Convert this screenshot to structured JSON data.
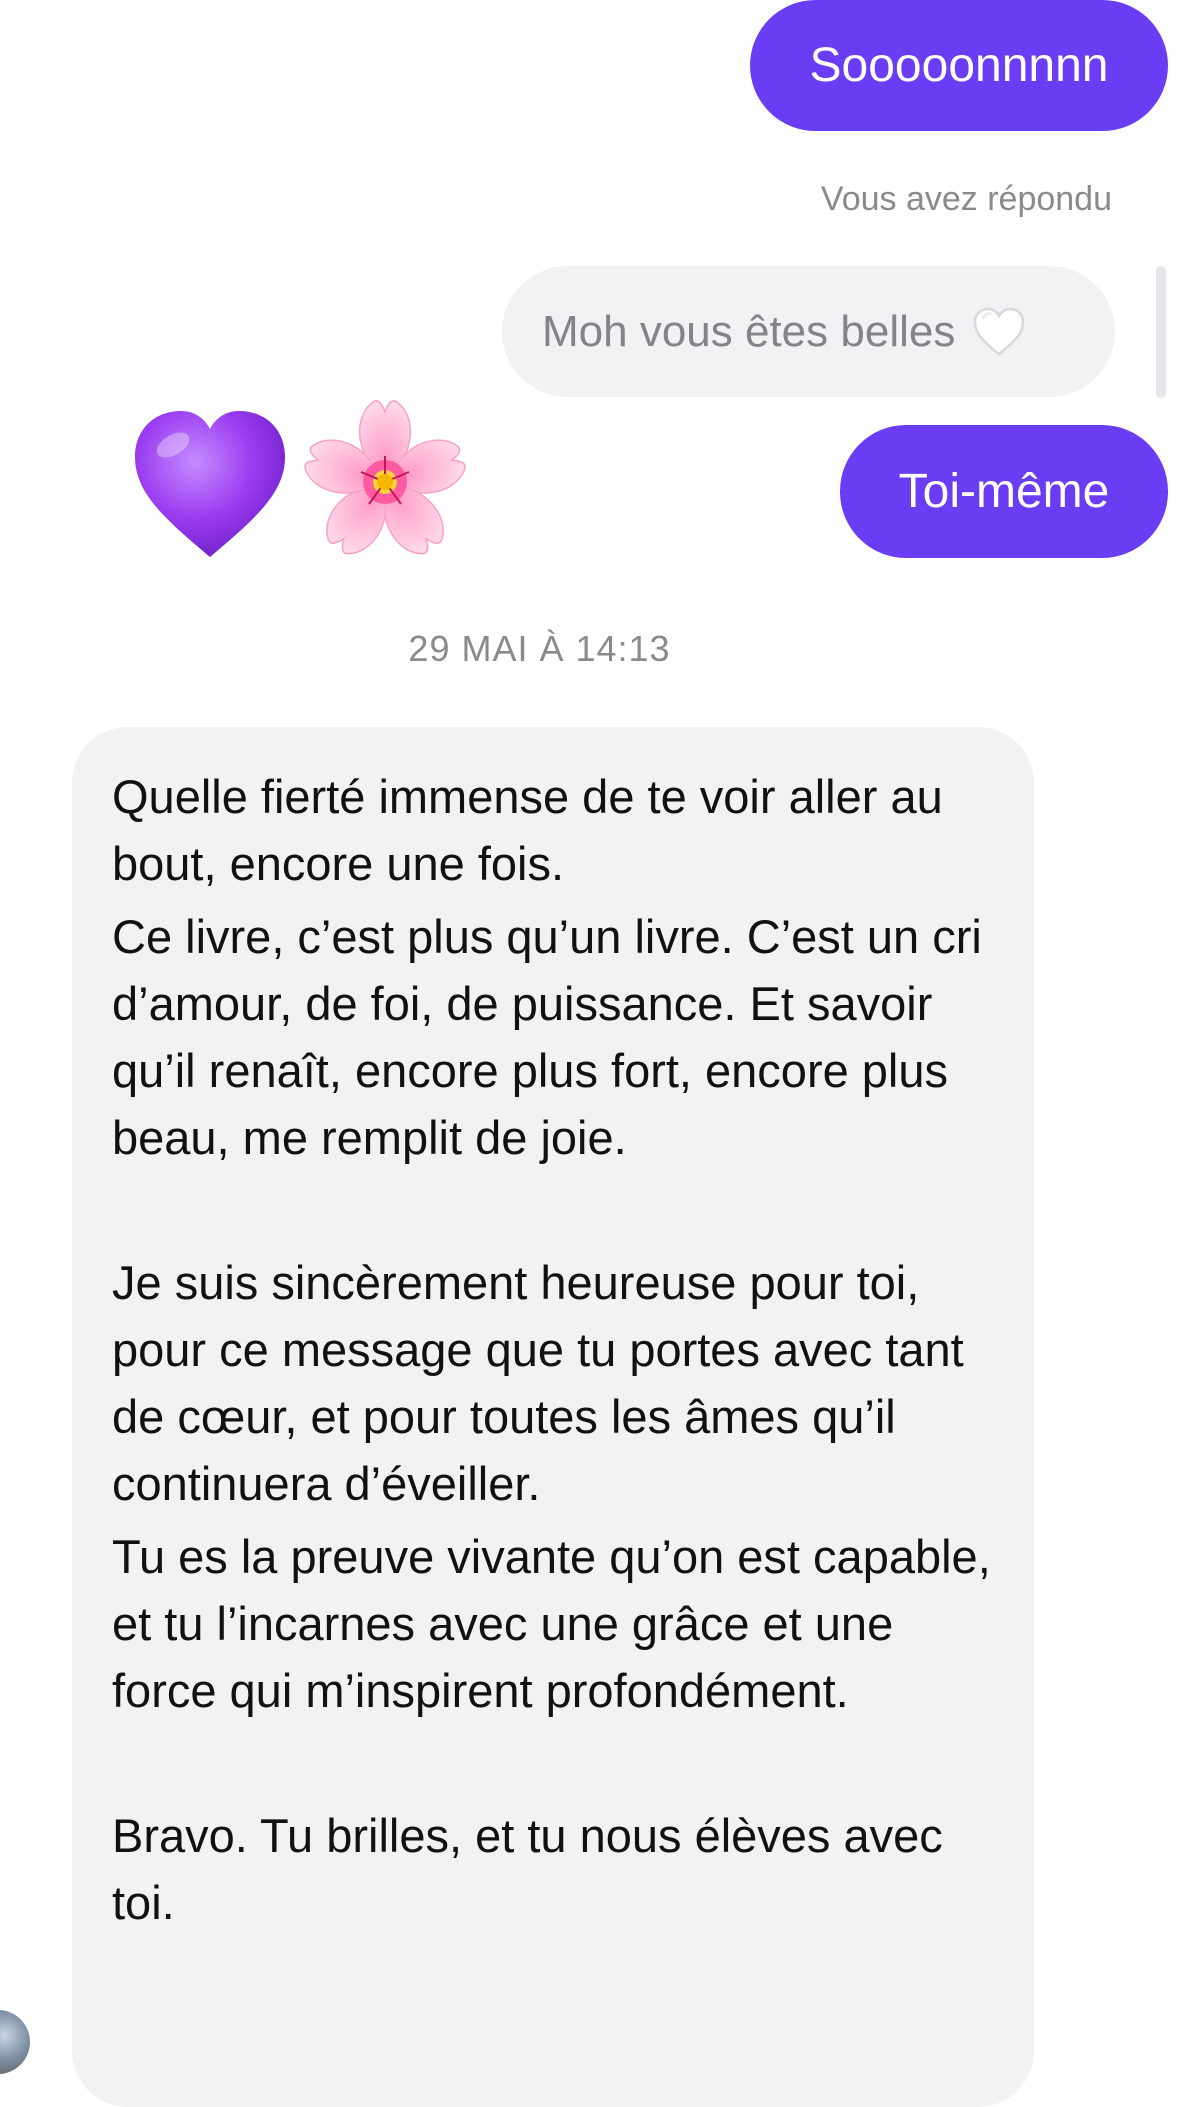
{
  "conversation": {
    "outgoing_1": "Sooooonnnnn",
    "reply_caption": "Vous avez répondu",
    "quoted_reply": "Moh vous êtes belles",
    "quoted_reply_emoji": "white-heart-icon",
    "reaction_emojis": [
      "purple-heart-icon",
      "cherry-blossom-icon"
    ],
    "outgoing_2": "Toi-même",
    "timestamp": "29 MAI À 14:13",
    "incoming_message": {
      "paragraphs": [
        "Quelle fierté immense de te voir aller au bout, encore une fois.",
        "Ce livre, c’est plus qu’un livre. C’est un cri d’amour, de foi, de puissance. Et savoir qu’il renaît, encore plus fort, encore plus beau, me remplit de joie.",
        "Je suis sincèrement heureuse pour toi, pour ce message que tu portes avec tant de cœur, et pour toutes les âmes qu’il continuera d’éveiller.",
        "Tu es la preuve vivante qu’on est capable, et tu l’incarnes avec une grâce et une force qui m’inspirent profondément.",
        "Bravo. Tu brilles, et tu nous élèves avec toi."
      ]
    }
  },
  "colors": {
    "outgoing_bubble": "#6a3df5",
    "incoming_bubble": "#f2f2f4",
    "meta_text": "#8a8a8e"
  }
}
